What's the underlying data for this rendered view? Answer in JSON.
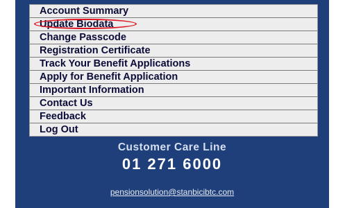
{
  "menu": {
    "items": [
      {
        "label": "Account Summary"
      },
      {
        "label": "Update Biodata"
      },
      {
        "label": "Change Passcode"
      },
      {
        "label": "Registration Certificate"
      },
      {
        "label": "Track Your Benefit Applications"
      },
      {
        "label": "Apply for Benefit Application"
      },
      {
        "label": "Important Information"
      },
      {
        "label": "Contact Us"
      },
      {
        "label": "Feedback"
      },
      {
        "label": "Log Out"
      }
    ]
  },
  "customer_care": {
    "title": "Customer Care Line",
    "phone": "01 271 6000"
  },
  "contact": {
    "email": "pensionsolution@stanbicibtc.com"
  },
  "colors": {
    "panel_background": "#1f3f7a",
    "menu_background": "#ededed",
    "menu_text": "#0b0b38",
    "highlight": "#e0141f"
  }
}
